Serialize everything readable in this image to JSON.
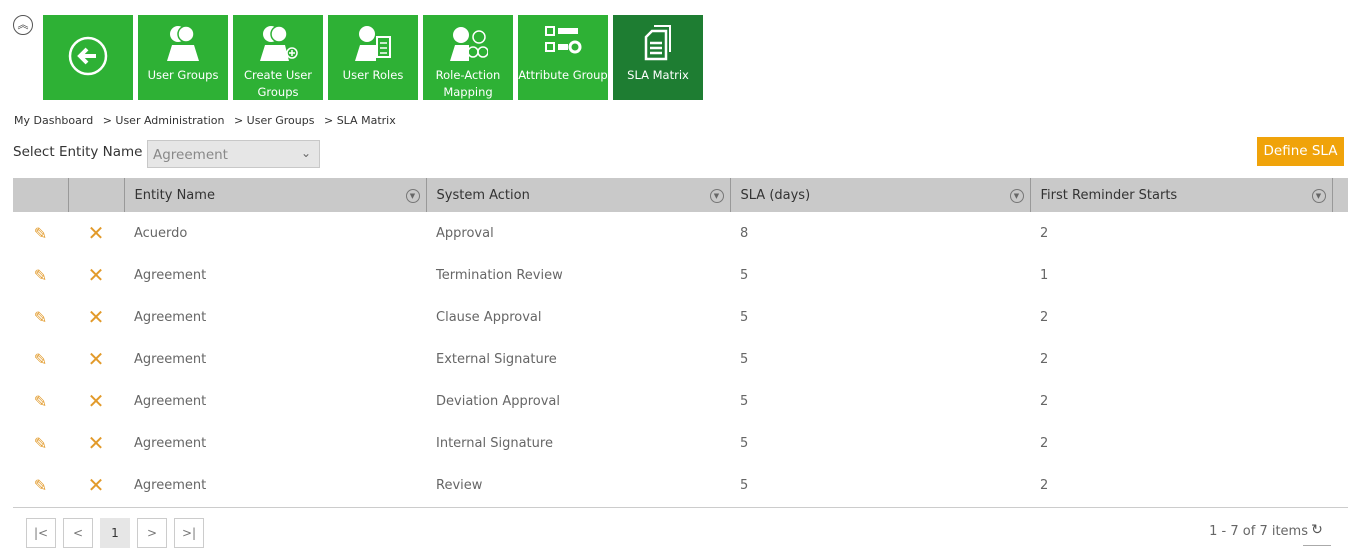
{
  "tiles": [
    {
      "label": "",
      "icon": "back-arrow-icon"
    },
    {
      "label": "User Groups",
      "icon": "user-groups-icon"
    },
    {
      "label": "Create User Groups",
      "icon": "create-user-groups-icon"
    },
    {
      "label": "User Roles",
      "icon": "user-roles-icon"
    },
    {
      "label": "Role-Action Mapping",
      "icon": "role-action-mapping-icon"
    },
    {
      "label": "Attribute Group",
      "icon": "attribute-group-icon"
    },
    {
      "label": "SLA Matrix",
      "icon": "sla-matrix-icon"
    }
  ],
  "breadcrumb": [
    "My Dashboard",
    ">  User Administration",
    ">  User Groups",
    ">  SLA Matrix"
  ],
  "filter": {
    "label": "Select Entity Name",
    "value": "Agreement"
  },
  "define_label": "Define SLA",
  "columns": [
    "Entity Name",
    "System Action",
    "SLA (days)",
    "First Reminder Starts"
  ],
  "rows": [
    [
      "Acuerdo",
      "Approval",
      "8",
      "2"
    ],
    [
      "Agreement",
      "Termination Review",
      "5",
      "1"
    ],
    [
      "Agreement",
      "Clause Approval",
      "5",
      "2"
    ],
    [
      "Agreement",
      "External Signature",
      "5",
      "2"
    ],
    [
      "Agreement",
      "Deviation Approval",
      "5",
      "2"
    ],
    [
      "Agreement",
      "Internal Signature",
      "5",
      "2"
    ],
    [
      "Agreement",
      "Review",
      "5",
      "2"
    ]
  ],
  "pager": {
    "first": "|<",
    "prev": "<",
    "page": "1",
    "next": ">",
    "last": ">|",
    "info": "1 - 7 of 7 items"
  },
  "colors": {
    "tile": "#2eb135",
    "tile_active": "#1e7d32",
    "accent": "#f0a30a"
  }
}
